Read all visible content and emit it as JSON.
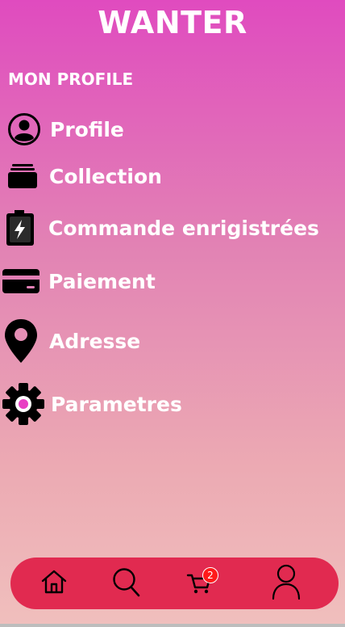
{
  "app": {
    "title": "WANTER"
  },
  "section": {
    "title": "MON PROFILE"
  },
  "menu": {
    "items": [
      {
        "label": "Profile",
        "icon": "user-circle-icon"
      },
      {
        "label": "Collection",
        "icon": "collection-stack-icon"
      },
      {
        "label": "Commande enrigistrées",
        "icon": "battery-charge-icon"
      },
      {
        "label": "Paiement",
        "icon": "credit-card-icon"
      },
      {
        "label": "Adresse",
        "icon": "location-pin-icon"
      },
      {
        "label": "Parametres",
        "icon": "gear-icon"
      }
    ]
  },
  "nav": {
    "items": [
      {
        "icon": "home-icon"
      },
      {
        "icon": "search-icon"
      },
      {
        "icon": "cart-icon",
        "badge": "2"
      },
      {
        "icon": "user-icon"
      }
    ]
  },
  "colors": {
    "gradient_top": "#e04bbf",
    "gradient_bottom": "#f0bfbd",
    "nav_bar": "#e12a50",
    "badge": "#ff1a1a",
    "gear_center": "#e83fc3"
  }
}
